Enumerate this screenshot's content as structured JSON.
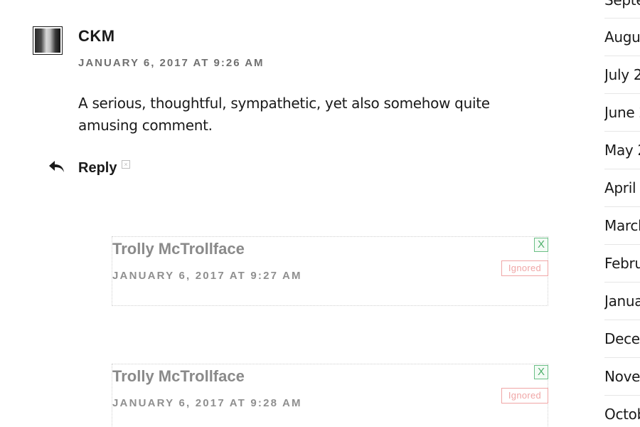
{
  "comment": {
    "author": "CKM",
    "timestamp": "January 6, 2017 at 9:26 am",
    "text": "A serious, thoughtful, sympathetic, yet also somehow quite amusing comment.",
    "reply_label": "Reply"
  },
  "ignored_replies": [
    {
      "author": "Trolly McTrollface",
      "timestamp": "January 6, 2017 at 9:27 am",
      "toggle_label": "X",
      "status": "Ignored"
    },
    {
      "author": "Trolly McTrollface",
      "timestamp": "January 6, 2017 at 9:28 am",
      "toggle_label": "X",
      "status": "Ignored"
    }
  ],
  "sidebar": {
    "archive_items": [
      {
        "label": "Septe"
      },
      {
        "label": "Augu"
      },
      {
        "label": "July 2"
      },
      {
        "label": "June 2"
      },
      {
        "label": "May 2"
      },
      {
        "label": "April 2"
      },
      {
        "label": "March"
      },
      {
        "label": "Febru"
      },
      {
        "label": "Janua"
      },
      {
        "label": "Dece"
      },
      {
        "label": "Nove"
      },
      {
        "label": "Octob"
      }
    ]
  },
  "icons": {
    "reply": "reply-arrow-icon",
    "close": "close-x-icon"
  },
  "colors": {
    "text": "#1a1a1a",
    "meta": "#707070",
    "ignored_text": "#8a8a8a",
    "toggle_green": "#4caf6a",
    "ignored_red": "#f0a6a6"
  }
}
